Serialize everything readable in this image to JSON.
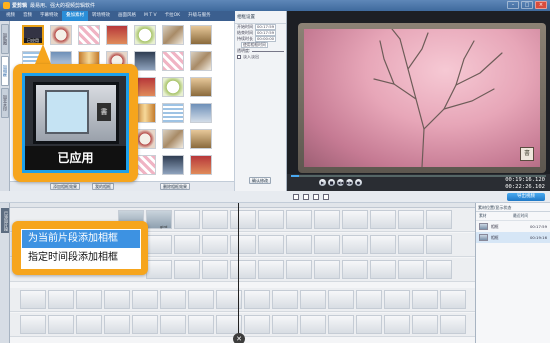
{
  "window": {
    "app_name": "爱剪辑",
    "title": "最易用、强大的视频剪辑软件",
    "minimize": "–",
    "maximize": "□",
    "close": "×"
  },
  "menu": {
    "items": [
      "视频",
      "音频",
      "字幕特效",
      "叠加素材",
      "转场特效",
      "画面风格",
      "M T V",
      "卡拉OK",
      "升级与服务"
    ],
    "active_index": 3
  },
  "sidebar": {
    "tabs": [
      "加贴图",
      "加相框",
      "加去水印"
    ],
    "active_index": 1
  },
  "thumbs": {
    "selected_label": "已应用"
  },
  "panel_buttons": {
    "add_frame": "添加相框效果",
    "my_frames": "我的相框",
    "delete_frame": "删除相框效果",
    "confirm": "确认修改"
  },
  "props": {
    "title": "相框设置",
    "rows": [
      {
        "label": "开始时间",
        "value": "00:17:59"
      },
      {
        "label": "结束时间",
        "value": "00:17:59"
      },
      {
        "label": "持续时长",
        "value": "00:00:00"
      }
    ],
    "action": "使用相框时间",
    "opacity_label": "透明度:",
    "checkbox_label": "淡入淡出"
  },
  "preview": {
    "seal_text": "書",
    "time_current": "00:19:16.120",
    "time_total": "00:22:26.102",
    "buttons": [
      "▶",
      "■",
      "◀◀",
      "▶▶",
      "●"
    ]
  },
  "toolbar": {
    "export": "导出视频"
  },
  "timeline": {
    "side_label": "已添加片段",
    "clip_name": "gird"
  },
  "right_panel": {
    "title": "素材位置/显示状态",
    "col_asset": "素材",
    "col_end": "最近时间",
    "rows": [
      {
        "name": "相框",
        "time": "00:17:59"
      },
      {
        "name": "相框",
        "time": "00:19:16"
      }
    ]
  },
  "callouts": {
    "applied": "已应用",
    "menu": [
      "为当前片段添加相框",
      "指定时间段添加相框"
    ]
  },
  "colors": {
    "accent": "#f6a51d",
    "highlight": "#3d92e2",
    "titlebar": "#3f6a9d"
  }
}
